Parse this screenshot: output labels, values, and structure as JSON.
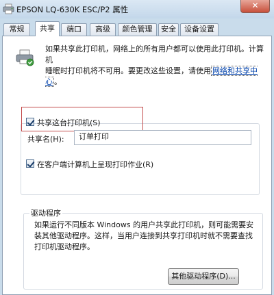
{
  "window": {
    "title": "EPSON LQ-630K ESC/P2 属性",
    "close_glyph": "✕"
  },
  "tabs": [
    {
      "label": "常规"
    },
    {
      "label": "共享"
    },
    {
      "label": "端口"
    },
    {
      "label": "高级"
    },
    {
      "label": "颜色管理"
    },
    {
      "label": "安全"
    },
    {
      "label": "设备设置"
    }
  ],
  "active_tab": "共享",
  "sharing": {
    "description_line1": "如果共享此打印机，网络上的所有用户都可以使用此打印机。计算机",
    "description_line2_prefix": "睡眠时打印机将不可用。要更改这些设置，请使用",
    "description_link": "网络和共享中心",
    "description_line2_suffix": "。",
    "share_checkbox_label": "共享这台打印机(S)",
    "share_checked": true,
    "share_name_label": "共享名(H):",
    "share_name_value": "订单打印",
    "render_client_label": "在客户端计算机上呈现打印作业(R)",
    "render_client_checked": true
  },
  "drivers": {
    "group_title": "驱动程序",
    "description_line1": "如果运行不同版本 Windows 的用户共享此打印机，则可能需要安",
    "description_line2": "装其他驱动程序。这样，当用户连接到共享打印机时就不需要查找",
    "description_line3": "打印机驱动程序。",
    "other_drivers_button": "其他驱动程序(D)..."
  },
  "icons": {
    "window_icon": "printer-icon",
    "sharing_icon": "shared-printer-icon"
  },
  "colors": {
    "window_frame": "#c9dceb",
    "link": "#0645ad",
    "highlight_border": "#c24a4a",
    "close_button": "#c8503b"
  }
}
